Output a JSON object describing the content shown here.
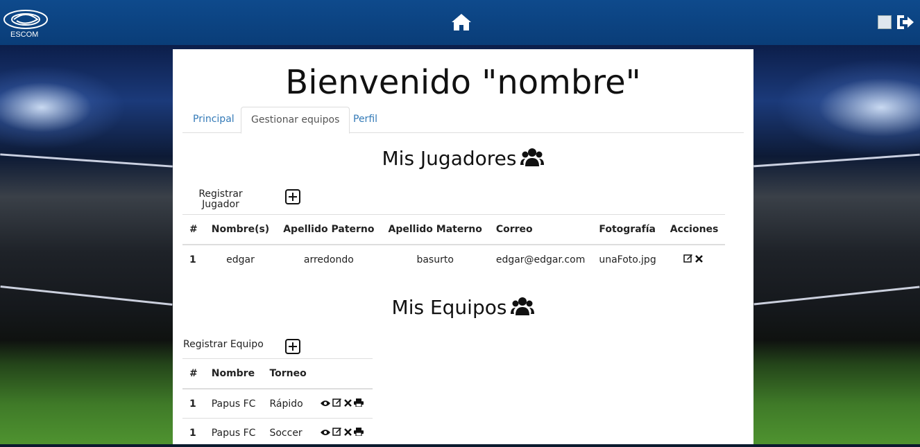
{
  "header": {
    "logo_text": "ESCOM"
  },
  "page": {
    "title": "Bienvenido \"nombre\""
  },
  "tabs": [
    {
      "label": "Principal"
    },
    {
      "label": "Gestionar equipos"
    },
    {
      "label": "Perfil"
    }
  ],
  "players": {
    "section_title": "Mis Jugadores",
    "register_label": "Registrar Jugador",
    "columns": [
      "#",
      "Nombre(s)",
      "Apellido Paterno",
      "Apellido Materno",
      "Correo",
      "Fotografía",
      "Acciones"
    ],
    "rows": [
      {
        "num": "1",
        "nombre": "edgar",
        "paterno": "arredondo",
        "materno": "basurto",
        "correo": "edgar@edgar.com",
        "foto": "unaFoto.jpg"
      }
    ]
  },
  "teams": {
    "section_title": "Mis Equipos",
    "register_label": "Registrar Equipo",
    "columns": [
      "#",
      "Nombre",
      "Torneo"
    ],
    "rows": [
      {
        "num": "1",
        "nombre": "Papus FC",
        "torneo": "Rápido"
      },
      {
        "num": "1",
        "nombre": "Papus FC",
        "torneo": "Soccer"
      }
    ]
  },
  "icons": {
    "home": "home-icon",
    "logout": "sign-out-icon",
    "users": "users-icon",
    "add": "plus-square-icon",
    "view": "eye-icon",
    "edit": "edit-icon",
    "delete": "times-icon",
    "print": "print-icon"
  }
}
